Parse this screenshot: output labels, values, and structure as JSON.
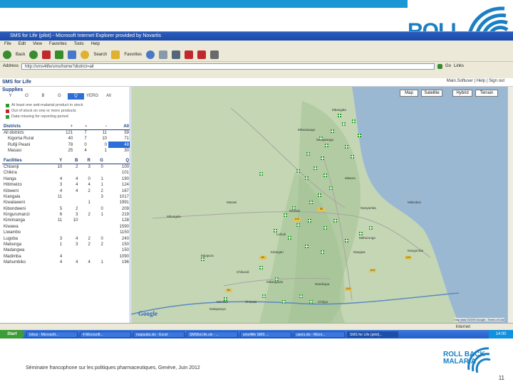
{
  "browser": {
    "title": "SMS for Life (pilot) - Microsoft Internet Explorer provided by Novartis",
    "menu": [
      "File",
      "Edit",
      "View",
      "Favorites",
      "Tools",
      "Help"
    ],
    "toolbar": {
      "back": "Back",
      "search": "Search",
      "favorites": "Favorites"
    },
    "address_label": "Address",
    "address_value": "http://sms4life/sms/home?district=all",
    "go": "Go",
    "links": "Links"
  },
  "app": {
    "name": "SMS for Life",
    "user": "Main.Softuser",
    "help": "Help",
    "signout": "Sign out",
    "supplies_title": "Supplies",
    "tabs": [
      "Y",
      "O",
      "B",
      "G",
      "Q",
      "YERG",
      "All"
    ],
    "legend": [
      {
        "label": "At least one anti-malarial product in stock",
        "color": "#2e9a32"
      },
      {
        "label": "Out of stock on one or more products",
        "color": "#c0282c"
      },
      {
        "label": "Data missing for reporting period",
        "color": "#2e9a32"
      }
    ],
    "districts": {
      "title": "Districts",
      "headers": [
        "+",
        "•",
        "-",
        "All"
      ],
      "rows": [
        {
          "name": "All districts",
          "v": [
            "121",
            "7",
            "11",
            "59"
          ]
        },
        {
          "name": "Kigoma Rural",
          "v": [
            "40",
            "7",
            "10",
            "71"
          ]
        },
        {
          "name": "Rufiji Pwani",
          "v": [
            "78",
            "0",
            "0",
            "48"
          ]
        },
        {
          "name": "Masasi",
          "v": [
            "25",
            "4",
            "1",
            "30"
          ]
        }
      ]
    },
    "facilities": {
      "title": "Facilities",
      "headers": [
        "Y",
        "B",
        "R",
        "G",
        "Q"
      ],
      "rows": [
        {
          "name": "Chisenji",
          "v": [
            "10",
            "2",
            "3",
            "0",
            "100"
          ]
        },
        {
          "name": "Chikira",
          "v": [
            "",
            "",
            "",
            "",
            "101"
          ]
        },
        {
          "name": "Hanga",
          "v": [
            "4",
            "4",
            "0",
            "1",
            "190"
          ]
        },
        {
          "name": "Hitimwizo",
          "v": [
            "3",
            "4",
            "4",
            "1",
            "124"
          ]
        },
        {
          "name": "Kibweni",
          "v": [
            "4",
            "4",
            "2",
            "2",
            "167"
          ]
        },
        {
          "name": "Kiangala",
          "v": [
            "11",
            "",
            "",
            "3",
            "1017"
          ]
        },
        {
          "name": "Kiwalaweni",
          "v": [
            "",
            "",
            "1",
            "",
            "1991"
          ]
        },
        {
          "name": "Kibondweni",
          "v": [
            "5",
            "2",
            "",
            "0",
            "209"
          ]
        },
        {
          "name": "Kingurumanzi",
          "v": [
            "6",
            "3",
            "2",
            "1",
            "219"
          ]
        },
        {
          "name": "Kimimanga",
          "v": [
            "11",
            "10",
            "",
            "",
            "128"
          ]
        },
        {
          "name": "Kiwawa",
          "v": [
            "",
            "",
            "",
            "",
            "1590"
          ]
        },
        {
          "name": "Liwambo",
          "v": [
            "",
            "",
            "",
            "",
            "1150"
          ]
        },
        {
          "name": "Lugoba",
          "v": [
            "3",
            "4",
            "2",
            "0",
            "240"
          ]
        },
        {
          "name": "Mabunga",
          "v": [
            "1",
            "3",
            "2",
            "2",
            "150"
          ]
        },
        {
          "name": "Madangwa",
          "v": [
            "",
            "",
            "",
            "",
            "150"
          ]
        },
        {
          "name": "Madimba",
          "v": [
            "4",
            "",
            "",
            "",
            "1090"
          ]
        },
        {
          "name": "Mahumbiko",
          "v": [
            "4",
            "4",
            "4",
            "1",
            "196"
          ]
        }
      ]
    }
  },
  "map": {
    "buttons": [
      "Map",
      "Satellite",
      "Hybrid",
      "Terrain"
    ],
    "places": [
      "Mbangala",
      "Mkwasanga",
      "Nangwanga",
      "Mtwara",
      "Nanyamba",
      "Mikindani",
      "Masasi",
      "Newala",
      "Lulindi",
      "Mahurunga",
      "Mpapura",
      "Kitangari",
      "Chikundi",
      "Namikupa",
      "Nangwa",
      "Mikangaula",
      "Chiwata",
      "Mnolela",
      "Chidya",
      "Mbangala",
      "Nakapanya",
      "Nangomba"
    ],
    "roads": [
      "B5",
      "A19",
      "B2",
      "R8",
      "A14",
      "A19",
      "A10"
    ],
    "google": "Google",
    "copyright": "Map data ©2009 Google - Terms of Use"
  },
  "statusbar": {
    "left": "",
    "zone": "Internet"
  },
  "taskbar": {
    "start": "Start",
    "tasks": [
      "Inbox - Microsoft...",
      "4 Microsoft...",
      "mapsubs.xls - Excel",
      "SMSforLife.xls - ...",
      "sms4life SMS ...",
      "users.xls - Micro...",
      "SMS for Life (pilot)..."
    ],
    "clock": "14:00"
  },
  "slide": {
    "brand_line1": "ROLL BACK",
    "brand_line2": "MALARIA",
    "footer": "Séminaire francophone sur les politiques pharmaceutiques, Genève, Juin 2012",
    "page": "11"
  },
  "colors": {
    "accent": "#1b97d6",
    "brand": "#1b7fc4",
    "in_stock": "#2e9a32",
    "out_of_stock": "#c0282c",
    "selected": "#2d6ed8"
  }
}
